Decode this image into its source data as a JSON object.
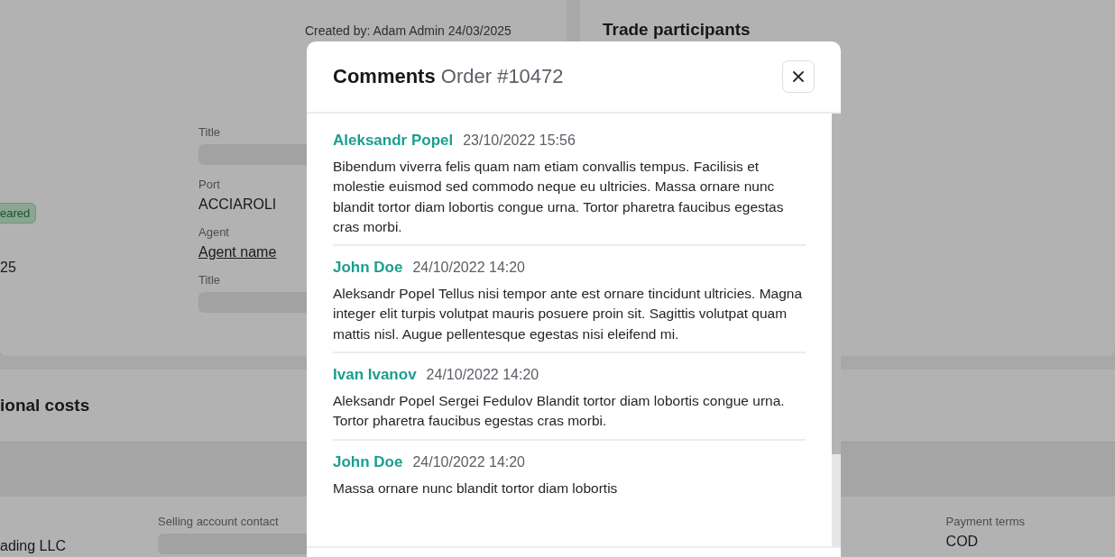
{
  "page": {
    "created_by": "Created by: Adam Admin 24/03/2025",
    "status_badge": "eared",
    "date_fragment": "25",
    "fields": [
      {
        "label": "Title",
        "kind": "empty"
      },
      {
        "label": "Port",
        "value": "ACCIAROLI",
        "kind": "text"
      },
      {
        "label": "Agent",
        "value": "Agent name",
        "kind": "link"
      },
      {
        "label": "Title",
        "kind": "empty"
      }
    ],
    "participants_title": "Trade participants",
    "costs_title": "ional costs",
    "bottom_row": {
      "company": "ading LLC",
      "selling_contact": {
        "label": "Selling account contact"
      },
      "payment_terms": {
        "label": "Payment terms",
        "value": "COD"
      }
    }
  },
  "modal": {
    "title": "Comments",
    "subtitle": "Order #10472",
    "comments": [
      {
        "author": "Aleksandr Popel",
        "date": "23/10/2022 15:56",
        "text": "Bibendum viverra felis quam nam etiam convallis tempus. Facilisis et molestie euismod sed commodo neque eu ultricies. Massa ornare nunc blandit tortor diam lobortis congue urna. Tortor pharetra faucibus egestas cras morbi."
      },
      {
        "author": "John Doe",
        "date": "24/10/2022 14:20",
        "text": "Aleksandr Popel Tellus nisi tempor ante est ornare tincidunt ultricies. Magna integer elit turpis volutpat mauris posuere proin sit. Sagittis volutpat quam mattis nisl. Augue pellentesque egestas nisi eleifend mi."
      },
      {
        "author": "Ivan Ivanov",
        "date": "24/10/2022 14:20",
        "text": "Aleksandr Popel Sergei Fedulov Blandit tortor diam lobortis congue urna. Tortor pharetra faucibus egestas cras morbi."
      },
      {
        "author": "John Doe",
        "date": "24/10/2022 14:20",
        "text": "Massa ornare nunc blandit tortor diam lobortis"
      }
    ]
  }
}
